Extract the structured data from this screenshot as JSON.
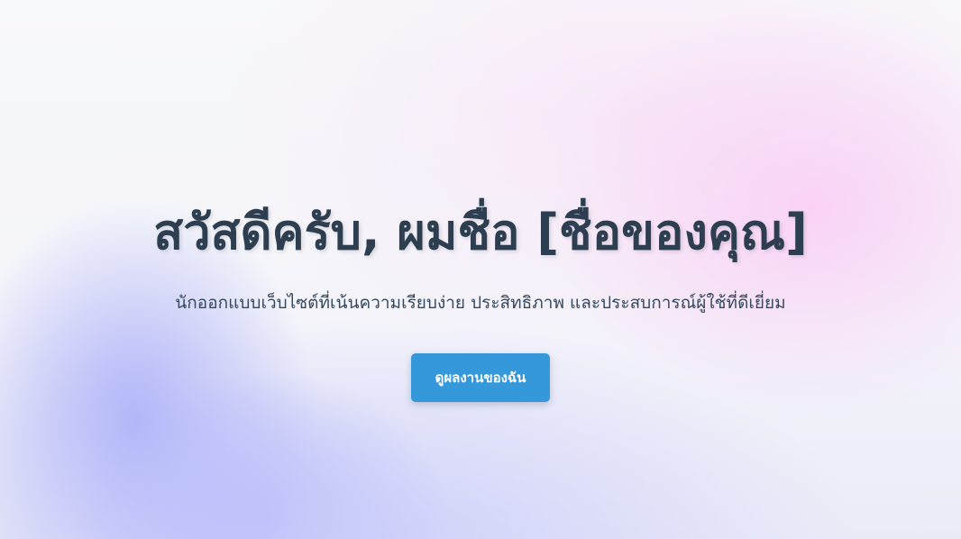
{
  "hero": {
    "title": "สวัสดีครับ, ผมชื่อ [ชื่อของคุณ]",
    "subtitle": "นักออกแบบเว็บไซต์ที่เน้นความเรียบง่าย ประสิทธิภาพ และประสบการณ์ผู้ใช้ที่ดีเยี่ยม",
    "cta_label": "ดูผลงานของฉัน"
  },
  "colors": {
    "title": "#2c3e50",
    "subtitle": "#34495e",
    "button": "#3498db",
    "button_text": "#ffffff",
    "gradient_pink": "#facdf5",
    "gradient_blue": "#a5aaf8"
  }
}
